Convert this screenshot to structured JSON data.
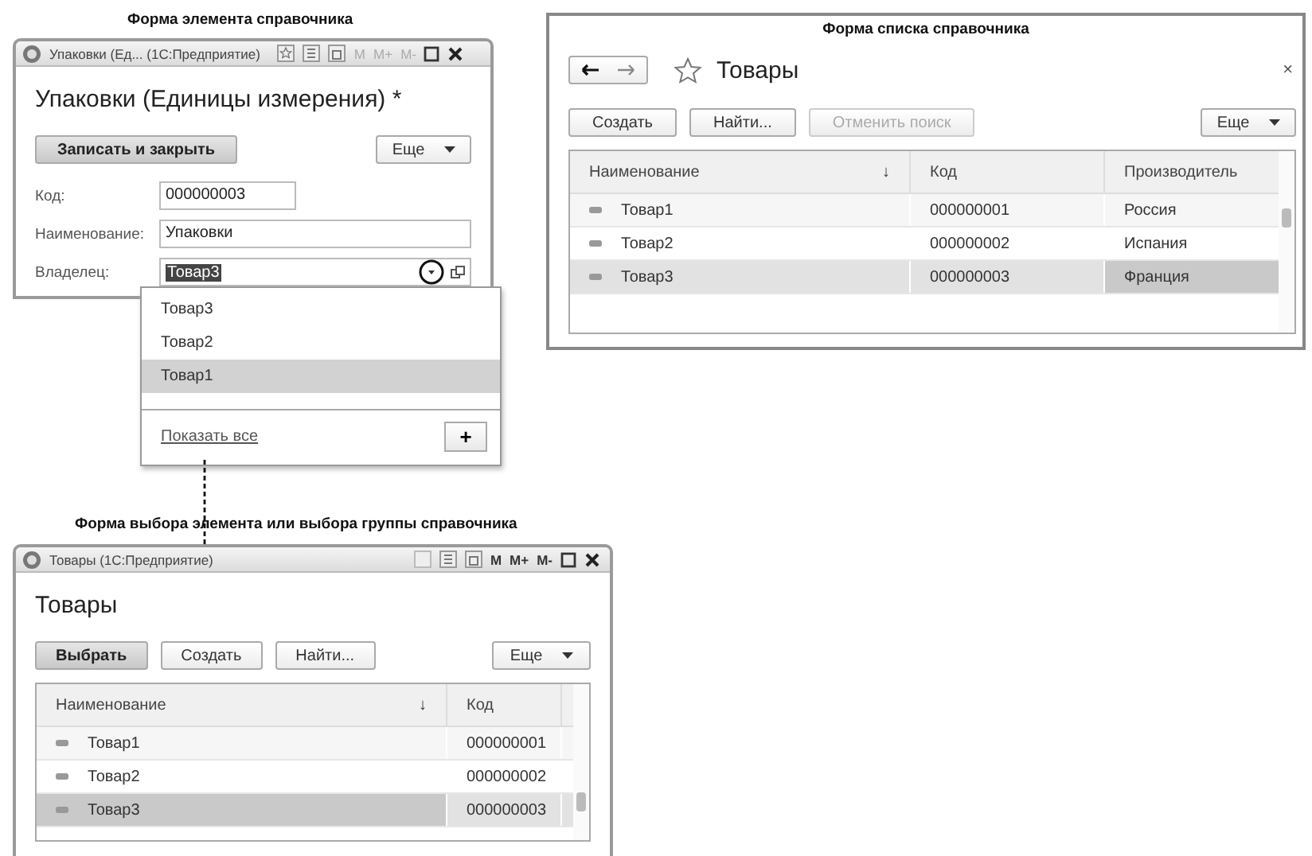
{
  "element_form": {
    "caption": "Форма элемента справочника",
    "window_title": "Упаковки (Ед... (1С:Предприятие)",
    "title_tools": [
      "M",
      "M+",
      "M-"
    ],
    "heading": "Упаковки (Единицы измерения) *",
    "buttons": [
      {
        "label": "Записать и закрыть",
        "kind": "default"
      },
      {
        "label": "Еще",
        "kind": "menu"
      }
    ],
    "fields": [
      {
        "label": "Код:",
        "value": "000000003",
        "kind": "short"
      },
      {
        "label": "Наименование:",
        "value": "Упаковки",
        "kind": "wide"
      },
      {
        "label": "Владелец:",
        "value": "Товар3",
        "kind": "choice"
      }
    ],
    "dropdown": {
      "items": [
        {
          "label": "Товар3",
          "selected": false
        },
        {
          "label": "Товар2",
          "selected": false
        },
        {
          "label": "Товар1",
          "selected": true
        }
      ],
      "show_all": "Показать все",
      "add_button": "+"
    }
  },
  "list_form": {
    "caption": "Форма списка справочника",
    "title": "Товары",
    "close": "×",
    "buttons": [
      {
        "label": "Создать",
        "kind": "normal",
        "disabled": false
      },
      {
        "label": "Найти...",
        "kind": "normal",
        "disabled": false
      },
      {
        "label": "Отменить поиск",
        "kind": "normal",
        "disabled": true
      },
      {
        "label": "Еще",
        "kind": "menu",
        "disabled": false
      }
    ],
    "table": {
      "columns": [
        {
          "label": "Наименование",
          "sort": "↓"
        },
        {
          "label": "Код"
        },
        {
          "label": "Производитель"
        }
      ],
      "rows": [
        {
          "selected": false,
          "cells": [
            {
              "text": "Товар1",
              "current": false
            },
            {
              "text": "000000001",
              "current": false
            },
            {
              "text": "Россия",
              "current": false
            }
          ]
        },
        {
          "selected": false,
          "cells": [
            {
              "text": "Товар2",
              "current": false
            },
            {
              "text": "000000002",
              "current": false
            },
            {
              "text": "Испания",
              "current": false
            }
          ]
        },
        {
          "selected": true,
          "cells": [
            {
              "text": "Товар3",
              "current": false
            },
            {
              "text": "000000003",
              "current": false
            },
            {
              "text": "Франция",
              "current": true
            }
          ]
        }
      ]
    }
  },
  "choice_form": {
    "caption": "Форма выбора элемента или выбора группы справочника",
    "window_title": "Товары (1С:Предприятие)",
    "title_tools": [
      "M",
      "M+",
      "M-"
    ],
    "heading": "Товары",
    "buttons": [
      {
        "label": "Выбрать",
        "kind": "default",
        "disabled": false
      },
      {
        "label": "Создать",
        "kind": "normal",
        "disabled": false
      },
      {
        "label": "Найти...",
        "kind": "normal",
        "disabled": false
      },
      {
        "label": "Еще",
        "kind": "menu",
        "disabled": false
      }
    ],
    "table": {
      "columns": [
        {
          "label": "Наименование",
          "sort": "↓"
        },
        {
          "label": "Код"
        }
      ],
      "rows": [
        {
          "selected": false,
          "cells": [
            {
              "text": "Товар1",
              "current": false
            },
            {
              "text": "000000001",
              "current": false
            }
          ]
        },
        {
          "selected": false,
          "cells": [
            {
              "text": "Товар2",
              "current": false
            },
            {
              "text": "000000002",
              "current": false
            }
          ]
        },
        {
          "selected": true,
          "cells": [
            {
              "text": "Товар3",
              "current": true
            },
            {
              "text": "000000003",
              "current": false
            }
          ]
        }
      ]
    }
  }
}
